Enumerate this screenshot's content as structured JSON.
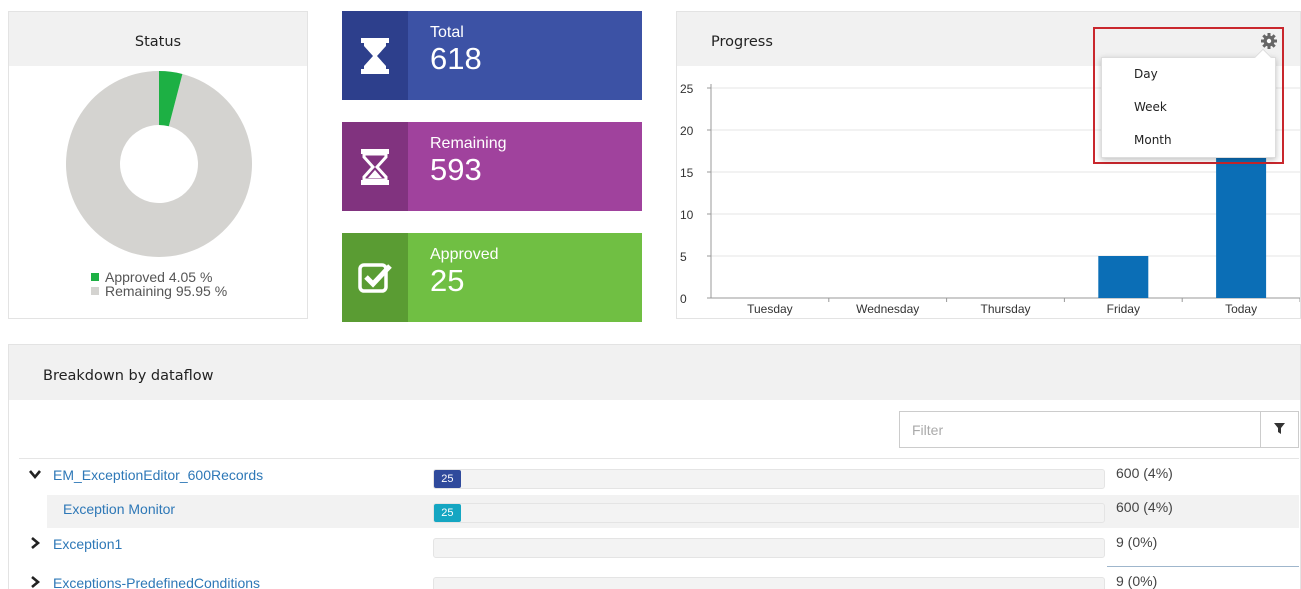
{
  "colors": {
    "approved": "#1db044",
    "remaining": "#d4d3d0",
    "total_tile": "#3c52a5",
    "remaining_tile": "#a0429d",
    "approved_tile": "#70bf43",
    "bar": "#0b6eb6",
    "badge_dataflow": "#2f4a9c",
    "badge_stage": "#15a6c2",
    "link": "#2e78b7",
    "highlight_border": "#c9272d"
  },
  "status": {
    "title": "Status",
    "approved_fraction": 0.0405,
    "legend": [
      {
        "label": "Approved 4.05 %",
        "color": "#1db044"
      },
      {
        "label": "Remaining 95.95 %",
        "color": "#d4d3d0"
      }
    ]
  },
  "tiles": {
    "total": {
      "label": "Total",
      "value": "618",
      "icon": "hourglass-icon"
    },
    "remaining": {
      "label": "Remaining",
      "value": "593",
      "icon": "hourglass-half-icon"
    },
    "approved": {
      "label": "Approved",
      "value": "25",
      "icon": "check-square-icon"
    }
  },
  "progress": {
    "title": "Progress",
    "settings_icon": "gear-icon",
    "menu": [
      "Day",
      "Week",
      "Month"
    ]
  },
  "chart_data": {
    "type": "bar",
    "categories": [
      "Tuesday",
      "Wednesday",
      "Thursday",
      "Friday",
      "Today"
    ],
    "values": [
      0,
      0,
      0,
      5,
      20
    ],
    "ylim": [
      0,
      25
    ],
    "yticks": [
      0,
      5,
      10,
      15,
      20,
      25
    ],
    "grid": true,
    "xlabel": "",
    "ylabel": ""
  },
  "breakdown": {
    "title": "Breakdown by dataflow",
    "filter_placeholder": "Filter",
    "rows": [
      {
        "label": "EM_ExceptionEditor_600Records",
        "badge": "25",
        "fraction": 0.04,
        "count": "600 (4%)",
        "expanded": true
      },
      {
        "label": "Exception Monitor",
        "badge": "25",
        "fraction": 0.04,
        "count": "600 (4%)"
      },
      {
        "label": "Exception1",
        "badge": "",
        "fraction": 0,
        "count": "9 (0%)",
        "expanded": false
      },
      {
        "label": "Exceptions-PredefinedConditions",
        "badge": "",
        "fraction": 0,
        "count": "9 (0%)",
        "expanded": false
      }
    ]
  }
}
